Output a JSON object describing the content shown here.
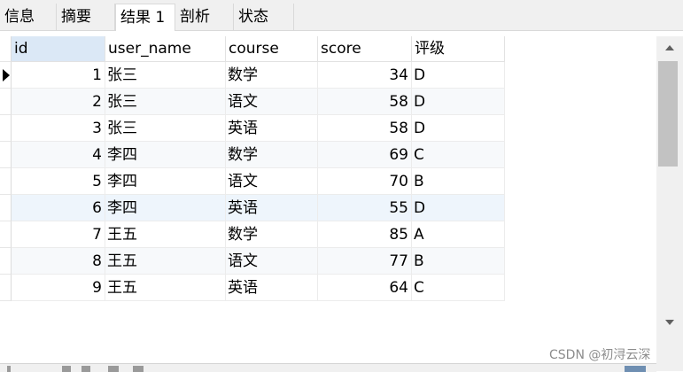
{
  "tabs": [
    {
      "label": "信息",
      "active": false
    },
    {
      "label": "摘要",
      "active": false
    },
    {
      "label": "结果 1",
      "active": true
    },
    {
      "label": "剖析",
      "active": false
    },
    {
      "label": "状态",
      "active": false
    }
  ],
  "grid": {
    "columns": [
      "id",
      "user_name",
      "course",
      "score",
      "评级"
    ],
    "rows": [
      {
        "id": "1",
        "user_name": "张三",
        "course": "数学",
        "score": "34",
        "grade": "D"
      },
      {
        "id": "2",
        "user_name": "张三",
        "course": "语文",
        "score": "58",
        "grade": "D"
      },
      {
        "id": "3",
        "user_name": "张三",
        "course": "英语",
        "score": "58",
        "grade": "D"
      },
      {
        "id": "4",
        "user_name": "李四",
        "course": "数学",
        "score": "69",
        "grade": "C"
      },
      {
        "id": "5",
        "user_name": "李四",
        "course": "语文",
        "score": "70",
        "grade": "B"
      },
      {
        "id": "6",
        "user_name": "李四",
        "course": "英语",
        "score": "55",
        "grade": "D"
      },
      {
        "id": "7",
        "user_name": "王五",
        "course": "数学",
        "score": "85",
        "grade": "A"
      },
      {
        "id": "8",
        "user_name": "王五",
        "course": "语文",
        "score": "77",
        "grade": "B"
      },
      {
        "id": "9",
        "user_name": "王五",
        "course": "英语",
        "score": "64",
        "grade": "C"
      }
    ]
  },
  "watermark": "CSDN @初浔云深"
}
